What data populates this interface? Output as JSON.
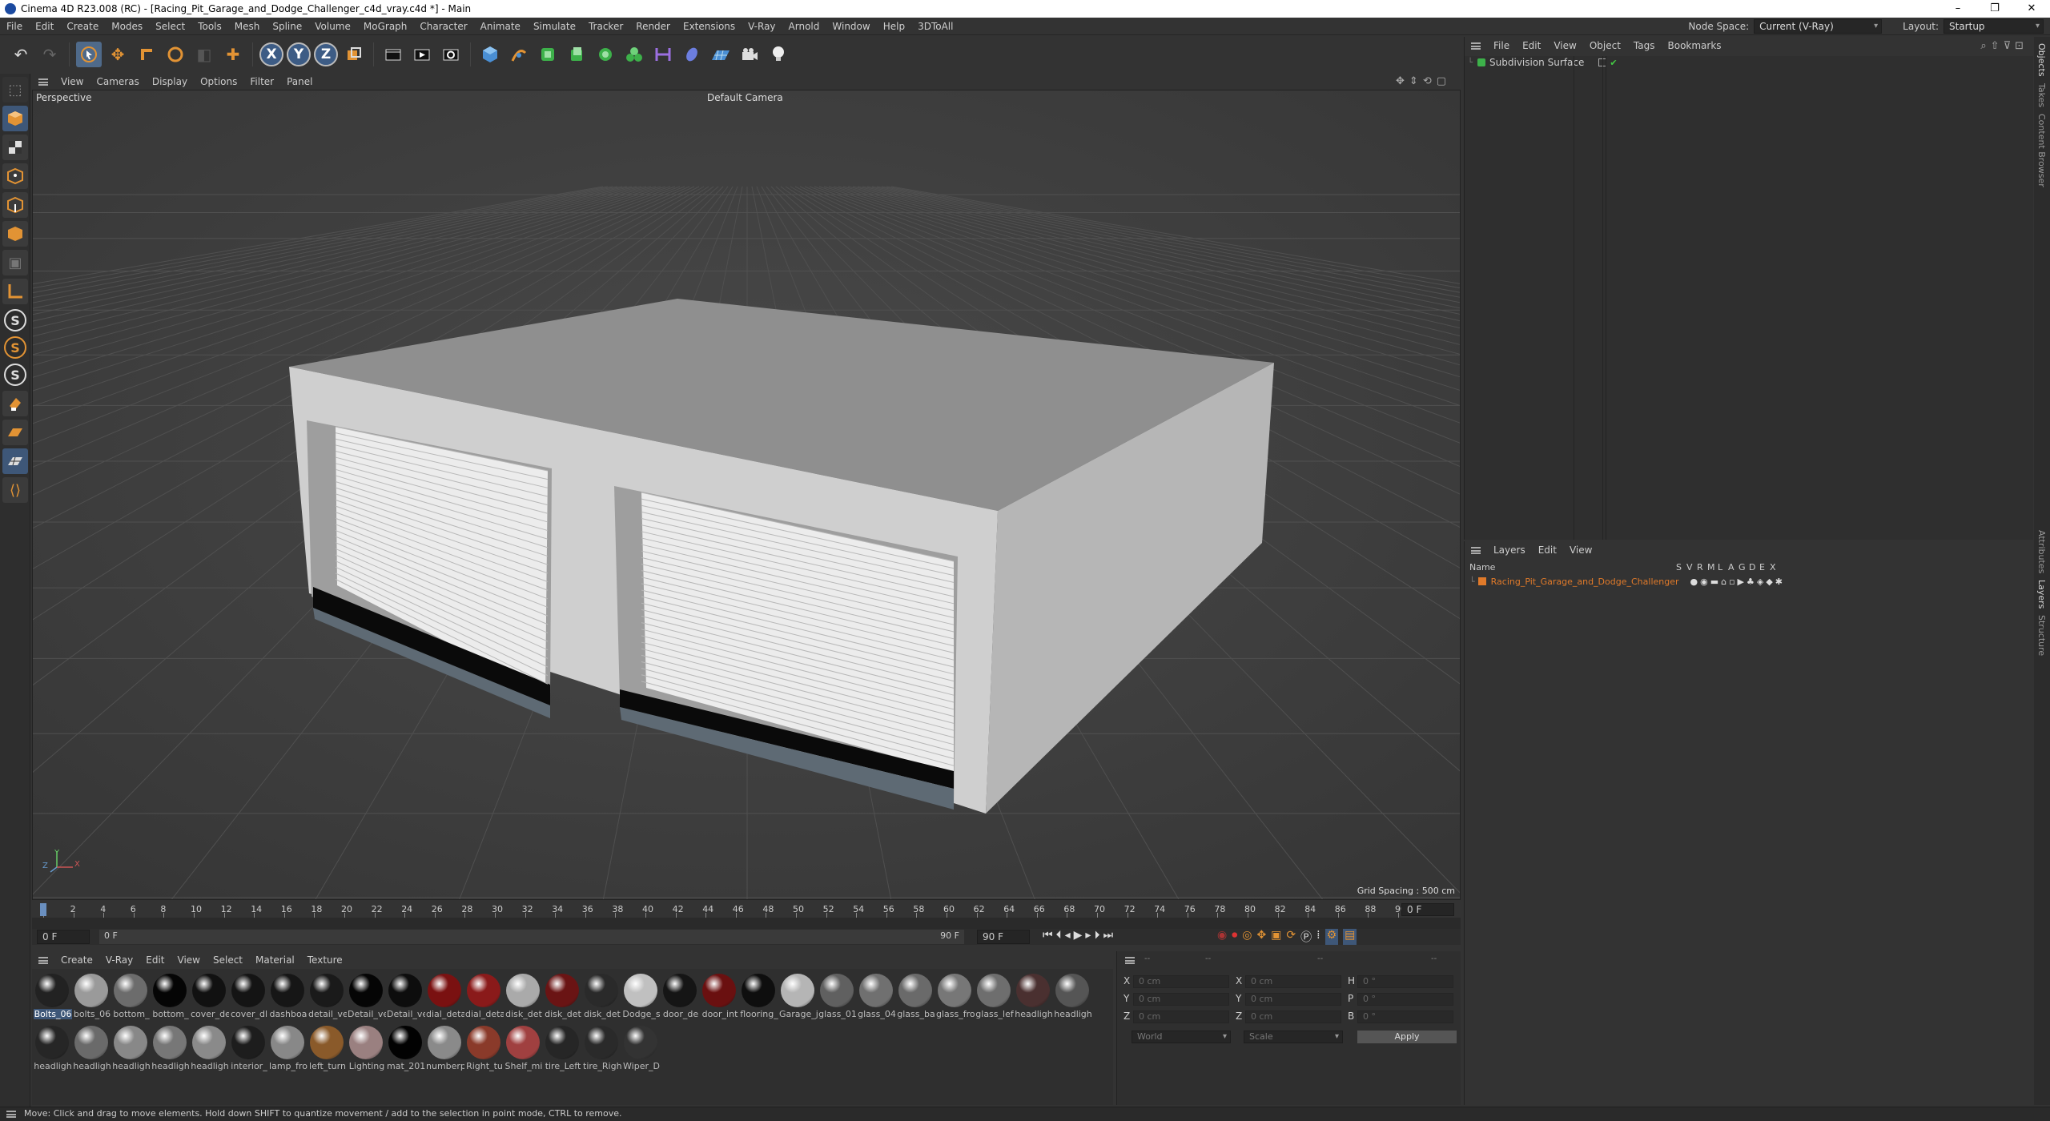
{
  "window": {
    "title": "Cinema 4D R23.008 (RC) - [Racing_Pit_Garage_and_Dodge_Challenger_c4d_vray.c4d *] - Main",
    "controls": [
      "–",
      "❐",
      "✕"
    ]
  },
  "menubar": {
    "items": [
      "File",
      "Edit",
      "Create",
      "Modes",
      "Select",
      "Tools",
      "Mesh",
      "Spline",
      "Volume",
      "MoGraph",
      "Character",
      "Animate",
      "Simulate",
      "Tracker",
      "Render",
      "Extensions",
      "V-Ray",
      "Arnold",
      "Window",
      "Help",
      "3DToAll"
    ],
    "node_space_label": "Node Space:",
    "node_space_value": "Current (V-Ray)",
    "layout_label": "Layout:",
    "layout_value": "Startup"
  },
  "toolbar": {
    "undo_icon": "undo-icon",
    "redo_icon": "redo-icon",
    "tools": [
      "select-icon",
      "move-icon",
      "scale-icon",
      "rotate-icon",
      "live-select-icon",
      "add-icon"
    ],
    "axes": [
      "X",
      "Y",
      "Z"
    ],
    "render_tools": [
      "world-coords-icon",
      "render-region-icon",
      "render-view-icon",
      "render-settings-icon"
    ],
    "object_tools": [
      "cube-icon",
      "pen-icon",
      "subdivision-icon",
      "extrude-icon",
      "cloner-icon",
      "hypernurbs-icon",
      "deformer-icon",
      "symmetry-icon",
      "paint-icon",
      "floor-icon",
      "camera-icon",
      "light-icon"
    ]
  },
  "viewport": {
    "menu": [
      "View",
      "Cameras",
      "Display",
      "Options",
      "Filter",
      "Panel"
    ],
    "view_name": "Perspective",
    "camera": "Default Camera",
    "grid_spacing": "Grid Spacing : 500 cm",
    "axis_y": "Y",
    "axis_x": "X",
    "axis_z": "Z"
  },
  "timeline": {
    "ticks": [
      "0",
      "2",
      "4",
      "6",
      "8",
      "10",
      "12",
      "14",
      "16",
      "18",
      "20",
      "22",
      "24",
      "26",
      "28",
      "30",
      "32",
      "34",
      "36",
      "38",
      "40",
      "42",
      "44",
      "46",
      "48",
      "50",
      "52",
      "54",
      "56",
      "58",
      "60",
      "62",
      "64",
      "66",
      "68",
      "70",
      "72",
      "74",
      "76",
      "78",
      "80",
      "82",
      "84",
      "86",
      "88",
      "90"
    ],
    "current_frame_end": "0 F",
    "start_frame": "0 F",
    "preview_start": "0 F",
    "preview_end": "90 F",
    "end_frame": "90 F"
  },
  "materials": {
    "menu": [
      "Create",
      "V-Ray",
      "Edit",
      "View",
      "Select",
      "Material",
      "Texture"
    ],
    "row1": [
      {
        "label": "Bolts_06",
        "color": "#222"
      },
      {
        "label": "bolts_06",
        "color": "#9a9a9a"
      },
      {
        "label": "bottom_",
        "color": "#6c6c6c"
      },
      {
        "label": "bottom_",
        "color": "#050505"
      },
      {
        "label": "cover_de",
        "color": "#111"
      },
      {
        "label": "cover_dl",
        "color": "#141414"
      },
      {
        "label": "dashboa",
        "color": "#161616"
      },
      {
        "label": "detail_ve",
        "color": "#1a1a1a"
      },
      {
        "label": "Detail_ve",
        "color": "#050505"
      },
      {
        "label": "Detail_ve",
        "color": "#0d0d0d"
      },
      {
        "label": "dial_deta",
        "color": "#7a1111"
      },
      {
        "label": "dial_deta",
        "color": "#8a1a1a"
      },
      {
        "label": "disk_det",
        "color": "#aaa"
      },
      {
        "label": "disk_det",
        "color": "#6a1414"
      },
      {
        "label": "disk_det",
        "color": "#2a2a2a"
      },
      {
        "label": "Dodge_s",
        "color": "#c0c0c0"
      },
      {
        "label": "door_de",
        "color": "#151515"
      },
      {
        "label": "door_int",
        "color": "#6a1010"
      },
      {
        "label": "flooring_",
        "color": "#0e0e0e"
      },
      {
        "label": "Garage_j",
        "color": "#b5b5b5"
      },
      {
        "label": "glass_01",
        "color": "#606060"
      },
      {
        "label": "glass_04",
        "color": "#707070"
      },
      {
        "label": "glass_ba",
        "color": "#6a6a6a"
      },
      {
        "label": "glass_fro",
        "color": "#777"
      },
      {
        "label": "glass_lef",
        "color": "#6e6e6e"
      },
      {
        "label": "headligh",
        "color": "#4a3030"
      },
      {
        "label": "headligh",
        "color": "#555"
      }
    ],
    "row2": [
      {
        "label": "headligh",
        "color": "#262626"
      },
      {
        "label": "headligh",
        "color": "#6a6a6a"
      },
      {
        "label": "headligh",
        "color": "#888"
      },
      {
        "label": "headligh",
        "color": "#777"
      },
      {
        "label": "headligh",
        "color": "#8a8a8a"
      },
      {
        "label": "interior_",
        "color": "#1d1d1d"
      },
      {
        "label": "lamp_fro",
        "color": "#888"
      },
      {
        "label": "left_turn",
        "color": "#8a5a2a"
      },
      {
        "label": "Lighting",
        "color": "#9a8080"
      },
      {
        "label": "mat_201",
        "color": "#020202"
      },
      {
        "label": "numberp",
        "color": "#8a8a8a"
      },
      {
        "label": "Right_tu",
        "color": "#8a3a2a"
      },
      {
        "label": "Shelf_mi",
        "color": "#a04040"
      },
      {
        "label": "tire_Left",
        "color": "#262626"
      },
      {
        "label": "tire_Righ",
        "color": "#2a2a2a"
      },
      {
        "label": "Wiper_D",
        "color": "#333"
      }
    ]
  },
  "coordinates": {
    "header": "--",
    "col_position": "--",
    "col_size": "--",
    "col_rotation": "--",
    "rows": [
      {
        "a": "X",
        "av": "0 cm",
        "b": "X",
        "bv": "0 cm",
        "c": "H",
        "cv": "0 °"
      },
      {
        "a": "Y",
        "av": "0 cm",
        "b": "Y",
        "bv": "0 cm",
        "c": "P",
        "cv": "0 °"
      },
      {
        "a": "Z",
        "av": "0 cm",
        "b": "Z",
        "bv": "0 cm",
        "c": "B",
        "cv": "0 °"
      }
    ],
    "mode_world": "World",
    "mode_scale": "Scale",
    "apply": "Apply"
  },
  "objects_panel": {
    "menu": [
      "File",
      "Edit",
      "View",
      "Object",
      "Tags",
      "Bookmarks"
    ],
    "item": "Subdivision Surface"
  },
  "layers_panel": {
    "menu": [
      "Layers",
      "Edit",
      "View"
    ],
    "col_name": "Name",
    "flags": [
      "S",
      "V",
      "R",
      "M",
      "L",
      "A",
      "G",
      "D",
      "E",
      "X"
    ],
    "layer_name": "Racing_Pit_Garage_and_Dodge_Challenger",
    "layer_color": "#e07a2a"
  },
  "right_tabs": [
    "Objects",
    "Takes",
    "Content Browser"
  ],
  "right_tabs_lower": [
    "Attributes",
    "Layers",
    "Structure"
  ],
  "statusbar": "Move: Click and drag to move elements. Hold down SHIFT to quantize movement / add to the selection in point mode, CTRL to remove."
}
